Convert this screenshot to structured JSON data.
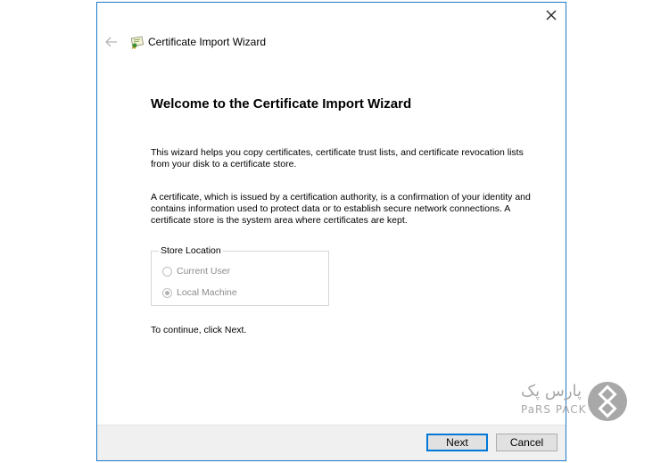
{
  "window": {
    "title": "Certificate Import Wizard",
    "heading": "Welcome to the Certificate Import Wizard",
    "paragraph1": "This wizard helps you copy certificates, certificate trust lists, and certificate revocation lists from your disk to a certificate store.",
    "paragraph2": "A certificate, which is issued by a certification authority, is a confirmation of your identity and contains information used to protect data or to establish secure network connections. A certificate store is the system area where certificates are kept.",
    "store_location": {
      "legend": "Store Location",
      "options": [
        {
          "label": "Current User",
          "selected": false,
          "enabled": false
        },
        {
          "label": "Local Machine",
          "selected": true,
          "enabled": false
        }
      ]
    },
    "continue_text": "To continue, click Next.",
    "buttons": {
      "next": "Next",
      "cancel": "Cancel"
    },
    "icons": {
      "close": "close-icon",
      "back": "back-arrow-icon",
      "wizard": "certificate-icon"
    }
  },
  "watermark": {
    "persian_text": "پارس پک",
    "latin_text": "PaRS PACK",
    "color": "#a8a8a8"
  },
  "colors": {
    "accent": "#0078d7",
    "window_border": "#1f78c8",
    "footer_bg": "#f0f0f0"
  }
}
